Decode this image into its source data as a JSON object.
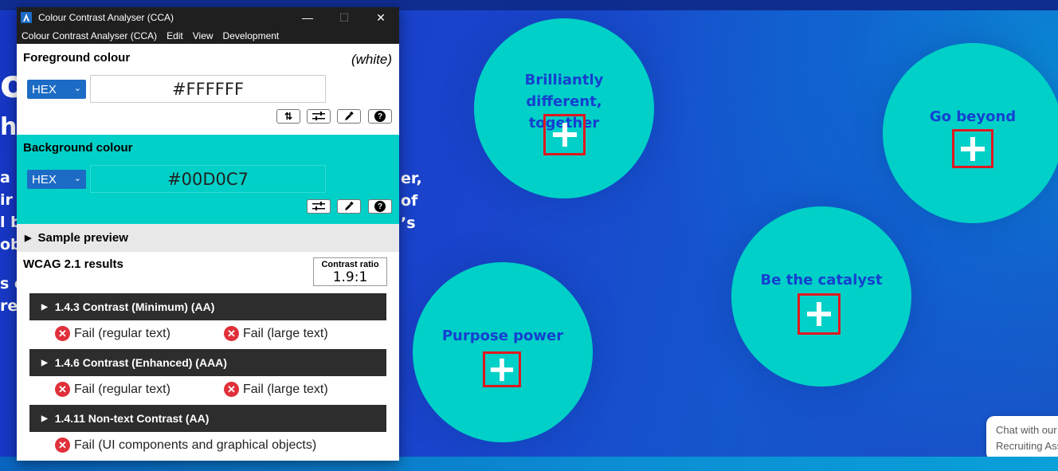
{
  "cca": {
    "title": "Colour Contrast Analyser (CCA)",
    "controls": {
      "minimize": "—",
      "maximize": "☐",
      "close": "✕"
    },
    "menu": [
      "Colour Contrast Analyser (CCA)",
      "Edit",
      "View",
      "Development"
    ],
    "foreground": {
      "title": "Foreground colour",
      "colour_name": "(white)",
      "format": "HEX",
      "value": "#FFFFFF",
      "tools": [
        "swap-icon",
        "sliders-icon",
        "eyedropper-icon",
        "help-icon"
      ]
    },
    "background": {
      "title": "Background colour",
      "format": "HEX",
      "value": "#00D0C7",
      "tools": [
        "sliders-icon",
        "eyedropper-icon",
        "help-icon"
      ]
    },
    "sample_preview": "Sample preview",
    "wcag": {
      "title": "WCAG 2.1 results",
      "contrast_ratio_label": "Contrast ratio",
      "contrast_ratio": "1.9:1",
      "criteria": [
        {
          "label": "1.4.3 Contrast (Minimum) (AA)",
          "results": [
            "Fail (regular text)",
            "Fail (large text)"
          ]
        },
        {
          "label": "1.4.6 Contrast (Enhanced) (AAA)",
          "results": [
            "Fail (regular text)",
            "Fail (large text)"
          ]
        },
        {
          "label": "1.4.11 Non-text Contrast (AA)",
          "results": [
            "Fail (UI components and graphical objects)"
          ]
        }
      ]
    }
  },
  "webpage": {
    "left_fragments": [
      "o",
      "hi",
      "a",
      "ir",
      "l b",
      "ob",
      "s c",
      "rec",
      "er,",
      "of",
      "’s"
    ],
    "circles": [
      {
        "label": "Brilliantly different, together"
      },
      {
        "label": "Go beyond"
      },
      {
        "label": "Be the catalyst"
      },
      {
        "label": "Purpose power"
      }
    ],
    "chat": {
      "line1": "Chat with our",
      "line2": "Recruiting Assistant"
    }
  },
  "colors": {
    "accent_teal": "#00D0C7",
    "page_blue": "#1B3FBF",
    "label_blue": "#1540D0",
    "focus_red": "#E0181F",
    "fail_red": "#E0303A"
  }
}
